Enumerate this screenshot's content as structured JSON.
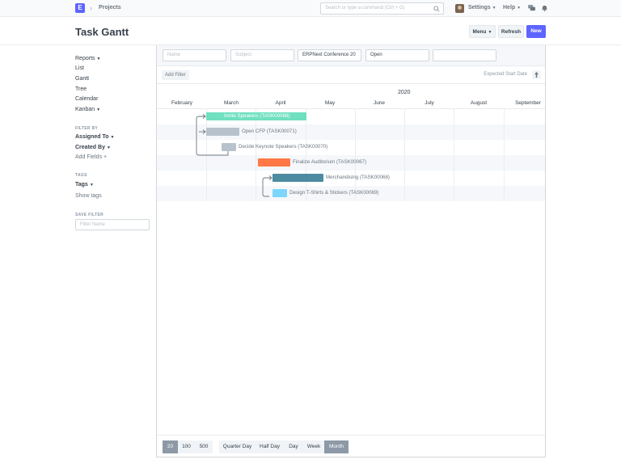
{
  "navbar": {
    "logo": "E",
    "breadcrumb": "Projects",
    "search_placeholder": "Search or type a command (Ctrl + G)",
    "settings_label": "Settings",
    "help_label": "Help"
  },
  "page": {
    "title": "Task Gantt",
    "menu_label": "Menu",
    "refresh_label": "Refresh",
    "new_label": "New"
  },
  "sidebar": {
    "views": [
      "Reports",
      "List",
      "Gantt",
      "Tree",
      "Calendar",
      "Kanban"
    ],
    "filter_by_heading": "FILTER BY",
    "assigned_to": "Assigned To",
    "created_by": "Created By",
    "add_fields": "Add Fields",
    "tags_heading": "TAGS",
    "tags_label": "Tags",
    "show_tags": "Show tags",
    "save_filter_heading": "SAVE FILTER",
    "filter_name_placeholder": "Filter Name"
  },
  "filters": {
    "name_placeholder": "Name",
    "subject_placeholder": "Subject",
    "project_value": "ERPNext Conference 20",
    "status_value": "Open",
    "blank_placeholder": ""
  },
  "toolbar": {
    "add_filter": "Add Filter",
    "sort_label": "Expected Start Date"
  },
  "gantt": {
    "year": "2020",
    "months": [
      "February",
      "March",
      "April",
      "May",
      "June",
      "July",
      "August",
      "September"
    ],
    "tasks": [
      {
        "label": "Invite Speakers (TASK00068)",
        "color": "#6fe0c0"
      },
      {
        "label": "Open CFP (TASK00071)",
        "color": "#b8c2cc"
      },
      {
        "label": "Decide Keynote Speakers (TASK00070)",
        "color": "#b8c2cc"
      },
      {
        "label": "Finalize Auditorium (TASK00067)",
        "color": "#ff7846"
      },
      {
        "label": "Merchandising (TASK00068)",
        "color": "#4d8ba1"
      },
      {
        "label": "Design T-Shirts & Stickers (TASK00069)",
        "color": "#7cd6fd"
      }
    ]
  },
  "paging": {
    "sizes": [
      "20",
      "100",
      "500"
    ],
    "views": [
      "Quarter Day",
      "Half Day",
      "Day",
      "Week",
      "Month"
    ],
    "active_size": "20",
    "active_view": "Month"
  }
}
